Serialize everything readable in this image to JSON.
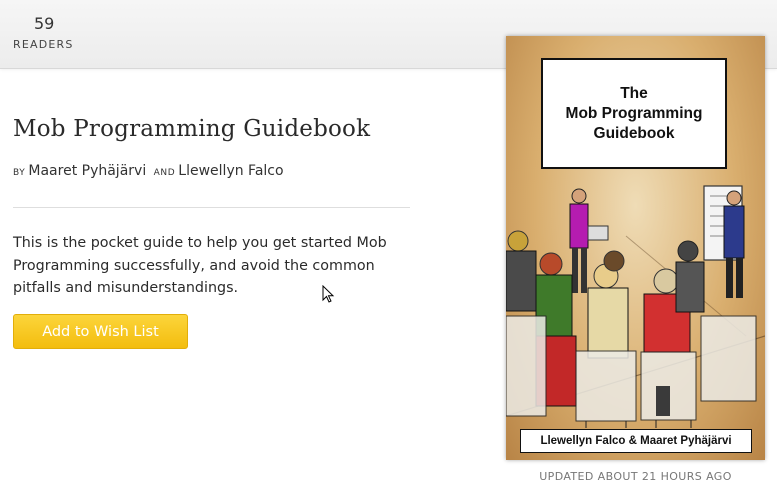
{
  "header": {
    "readers_count": "59",
    "readers_label": "READERS"
  },
  "book": {
    "title": "Mob Programming Guidebook",
    "by_label": "BY",
    "author_1": "Maaret Pyhäjärvi",
    "and_label": "AND",
    "author_2": "Llewellyn Falco",
    "description": "This is the pocket guide to help you get started Mob Programming successfully, and avoid the common pitfalls and misunderstandings."
  },
  "actions": {
    "wishlist_label": "Add to Wish List",
    "button_color": "#f7c51e"
  },
  "cover": {
    "title_line_1": "The",
    "title_line_2": "Mob Programming",
    "title_line_3": "Guidebook",
    "authors": "Llewellyn Falco & Maaret Pyhäjärvi"
  },
  "updated_text": "UPDATED ABOUT 21 HOURS AGO"
}
